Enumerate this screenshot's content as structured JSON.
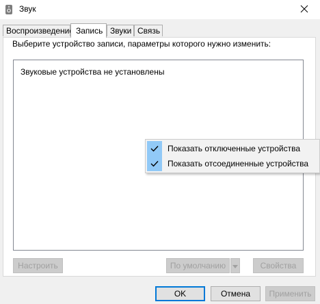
{
  "window": {
    "title": "Звук",
    "icon": "speaker-icon",
    "close_icon": "close-icon"
  },
  "tabs": [
    {
      "label": "Воспроизведение",
      "active": false
    },
    {
      "label": "Запись",
      "active": true
    },
    {
      "label": "Звуки",
      "active": false
    },
    {
      "label": "Связь",
      "active": false
    }
  ],
  "panel": {
    "instruction": "Выберите устройство записи, параметры которого нужно изменить:",
    "empty_message": "Звуковые устройства не установлены"
  },
  "context_menu": {
    "items": [
      {
        "label": "Показать отключенные устройства",
        "checked": true,
        "icon": "checkmark-icon"
      },
      {
        "label": "Показать отсоединенные устройства",
        "checked": true,
        "icon": "checkmark-icon"
      }
    ]
  },
  "panel_buttons": {
    "configure": "Настроить",
    "default": "По умолчанию",
    "properties": "Свойства"
  },
  "dialog_buttons": {
    "ok": "OK",
    "cancel": "Отмена",
    "apply": "Применить"
  },
  "colors": {
    "accent": "#0078d7",
    "check_highlight": "#91c9f7",
    "disabled_text": "#a0a0a0"
  }
}
